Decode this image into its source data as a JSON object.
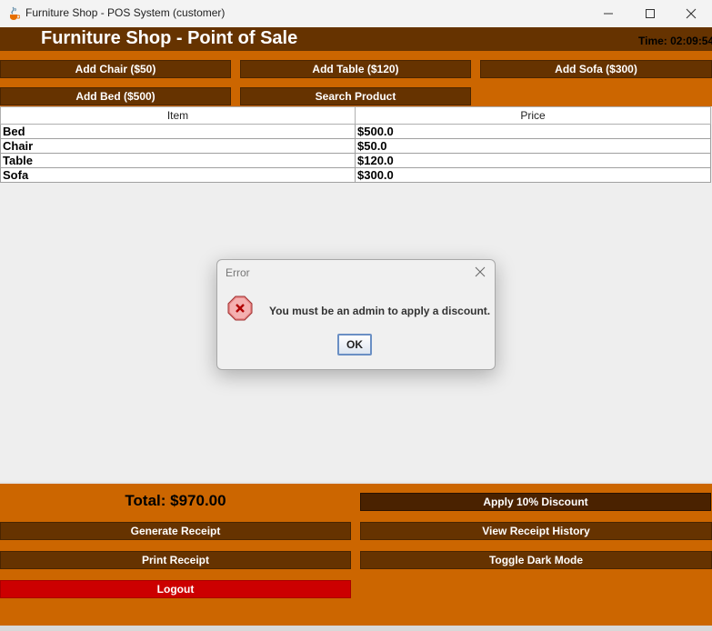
{
  "window": {
    "title": "Furniture Shop - POS System (customer)",
    "controls": {
      "minimize_icon": "minimize-icon",
      "maximize_icon": "maximize-icon",
      "close_icon": "close-icon"
    }
  },
  "header": {
    "title": "Furniture Shop - Point of Sale",
    "time": "Time: 02:09:54"
  },
  "products": {
    "add_chair": "Add Chair ($50)",
    "add_table": "Add Table ($120)",
    "add_sofa": "Add Sofa ($300)",
    "add_bed": "Add Bed ($500)",
    "search": "Search Product"
  },
  "table": {
    "columns": [
      "Item",
      "Price"
    ],
    "rows": [
      [
        "Bed",
        "$500.0"
      ],
      [
        "Chair",
        "$50.0"
      ],
      [
        "Table",
        "$120.0"
      ],
      [
        "Sofa",
        "$300.0"
      ]
    ]
  },
  "footer": {
    "total": "Total: $970.00",
    "apply_discount": "Apply 10% Discount",
    "generate_receipt": "Generate Receipt",
    "view_history": "View Receipt History",
    "print_receipt": "Print Receipt",
    "toggle_dark": "Toggle Dark Mode",
    "logout": "Logout"
  },
  "dialog": {
    "title": "Error",
    "message": "You must be an admin to apply a discount.",
    "ok": "OK",
    "icon": "error-icon"
  },
  "colors": {
    "header_brown": "#663300",
    "accent_orange": "#cc6600",
    "discount_dark": "#4a2200",
    "logout_red": "#cc0000"
  }
}
